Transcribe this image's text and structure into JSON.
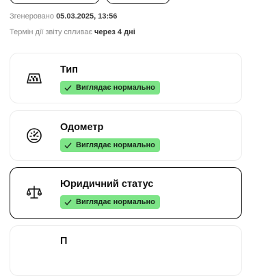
{
  "report": {
    "generated_label": "Згенеровано",
    "generated_value": "05.03.2025, 13:56",
    "expiry_label": "Термін дії звіту спливає",
    "expiry_value": "через 4 дні"
  },
  "checks": [
    {
      "title": "Тип",
      "status": "Виглядає нормально",
      "icon": "taxi-icon"
    },
    {
      "title": "Одометр",
      "status": "Виглядає нормально",
      "icon": "odometer-icon"
    },
    {
      "title": "Юридичний статус",
      "status": "Виглядає нормально",
      "icon": "scales-icon"
    },
    {
      "title": "П",
      "status": "",
      "icon": "unknown-icon"
    }
  ],
  "colors": {
    "badge_bg": "#7de487",
    "muted_text": "#8a8a8a"
  }
}
